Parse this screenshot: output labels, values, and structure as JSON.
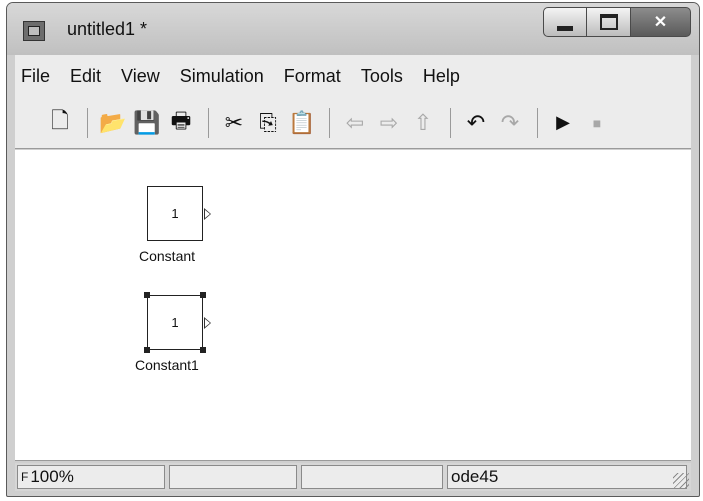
{
  "window": {
    "title": "untitled1 *"
  },
  "menu": [
    "File",
    "Edit",
    "View",
    "Simulation",
    "Format",
    "Tools",
    "Help"
  ],
  "toolbar": {
    "icons": [
      "new-icon",
      "open-icon",
      "save-icon",
      "print-icon",
      "cut-icon",
      "copy-icon",
      "paste-icon",
      "back-icon",
      "forward-icon",
      "up-icon",
      "undo-icon",
      "redo-icon",
      "run-icon",
      "stop-icon"
    ]
  },
  "blocks": [
    {
      "value": "1",
      "label": "Constant",
      "selected": false
    },
    {
      "value": "1",
      "label": "Constant1",
      "selected": true
    }
  ],
  "status": {
    "prefix": "F",
    "zoom": "100%",
    "solver": "ode45"
  }
}
